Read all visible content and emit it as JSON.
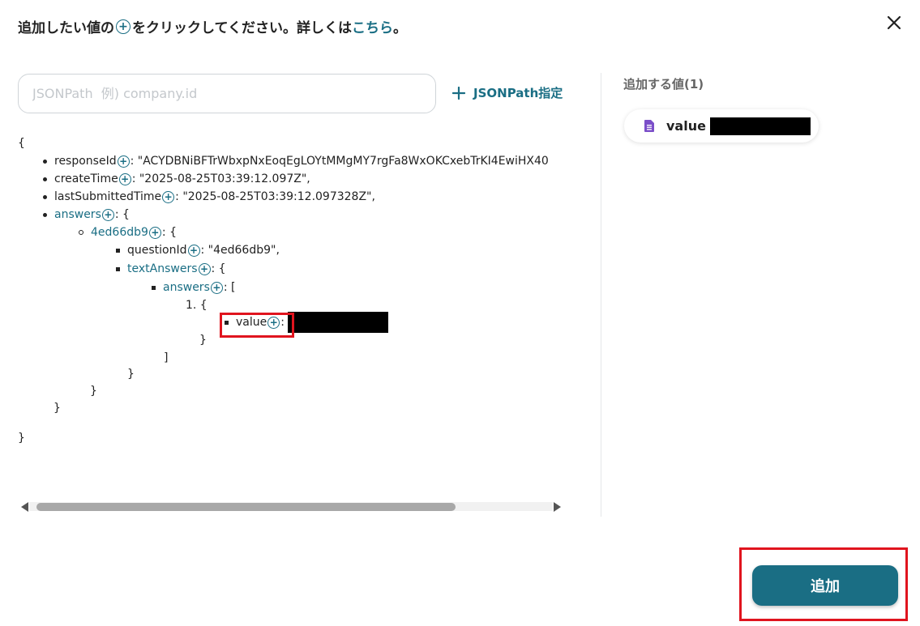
{
  "header": {
    "instruction_prefix": "追加したい値の",
    "instruction_suffix": "をクリックしてください。詳しくは",
    "link_text": "こちら",
    "trailing": "。"
  },
  "search": {
    "placeholder": "JSONPath  例) company.id",
    "value": ""
  },
  "jsonpath_button": {
    "label": "JSONPath指定"
  },
  "tree": {
    "open_brace": "{",
    "close_brace": "}",
    "responseId": {
      "key": "responseId",
      "value": ": \"ACYDBNiBFTrWbxpNxEoqEgLOYtMMgMY7rgFa8WxOKCxebTrKI4EwiHX40"
    },
    "createTime": {
      "key": "createTime",
      "value": ": \"2025-08-25T03:39:12.097Z\","
    },
    "lastSubmittedTime": {
      "key": "lastSubmittedTime",
      "value": ": \"2025-08-25T03:39:12.097328Z\","
    },
    "answers": {
      "key": "answers",
      "suffix": ": {"
    },
    "answer_id": {
      "key": "4ed66db9",
      "suffix": ": {"
    },
    "questionId": {
      "key": "questionId",
      "value": ": \"4ed66db9\","
    },
    "textAnswers": {
      "key": "textAnswers",
      "suffix": ": {"
    },
    "inner_answers": {
      "key": "answers",
      "suffix": ": ["
    },
    "list_item_marker": "1. {",
    "value_item": {
      "key": "value",
      "suffix": ":"
    },
    "close_item": "}",
    "close_array": "]",
    "close_text_answers": "}",
    "close_answer_id": "}",
    "close_answers": "}",
    "close_root": "}"
  },
  "added_panel": {
    "title": "追加する値(1)",
    "chips": [
      {
        "label": "value",
        "icon": "document-icon",
        "icon_color": "#7b4fc9"
      }
    ]
  },
  "actions": {
    "add_label": "追加"
  },
  "colors": {
    "accent": "#1a6e84",
    "highlight": "#e0141e"
  }
}
